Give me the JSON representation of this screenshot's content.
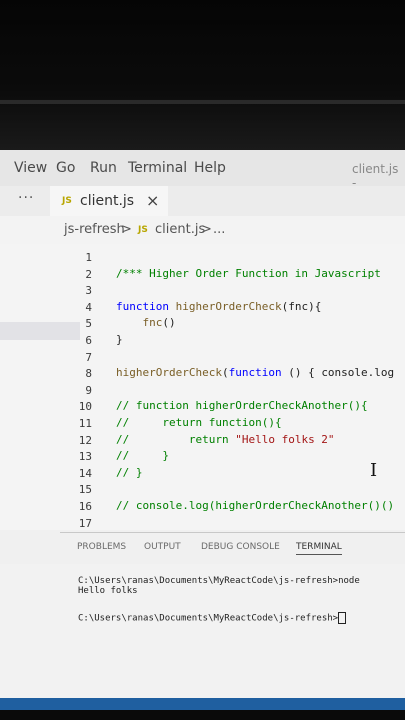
{
  "menu": {
    "view": "View",
    "go": "Go",
    "run": "Run",
    "terminal": "Terminal",
    "help": "Help",
    "window_title": "client.js -"
  },
  "tabs": {
    "overflow": "···",
    "badge": "JS",
    "file": "client.js",
    "close": "×"
  },
  "breadcrumb": {
    "folder": "js-refresh",
    "sep1": ">",
    "badge": "JS",
    "file": "client.js",
    "sep2": ">",
    "more": "..."
  },
  "code_lines": [
    {
      "n": "1",
      "text": ""
    },
    {
      "n": "2",
      "text": "/*** Higher Order Function in Javascript"
    },
    {
      "n": "3",
      "text": ""
    },
    {
      "n": "4",
      "text": "function higherOrderCheck(fnc){"
    },
    {
      "n": "5",
      "text": "    fnc()"
    },
    {
      "n": "6",
      "text": "}"
    },
    {
      "n": "7",
      "text": ""
    },
    {
      "n": "8",
      "text": "higherOrderCheck(function () { console.log"
    },
    {
      "n": "9",
      "text": ""
    },
    {
      "n": "10",
      "text": "// function higherOrderCheckAnother(){"
    },
    {
      "n": "11",
      "text": "//     return function(){"
    },
    {
      "n": "12",
      "text": "//         return \"Hello folks 2\""
    },
    {
      "n": "13",
      "text": "//     }"
    },
    {
      "n": "14",
      "text": "// }"
    },
    {
      "n": "15",
      "text": ""
    },
    {
      "n": "16",
      "text": "// console.log(higherOrderCheckAnother()()"
    },
    {
      "n": "17",
      "text": ""
    }
  ],
  "panel": {
    "problems": "PROBLEMS",
    "output": "OUTPUT",
    "debug": "DEBUG CONSOLE",
    "terminal": "TERMINAL"
  },
  "terminal": {
    "line1": "C:\\Users\\ranas\\Documents\\MyReactCode\\js-refresh>node",
    "line2": "Hello folks",
    "line3": "C:\\Users\\ranas\\Documents\\MyReactCode\\js-refresh>"
  },
  "colors": {
    "keyword": "#0000ff",
    "function": "#795e26",
    "comment": "#008000",
    "string": "#a31515",
    "statusbar": "#1f5fa0"
  }
}
